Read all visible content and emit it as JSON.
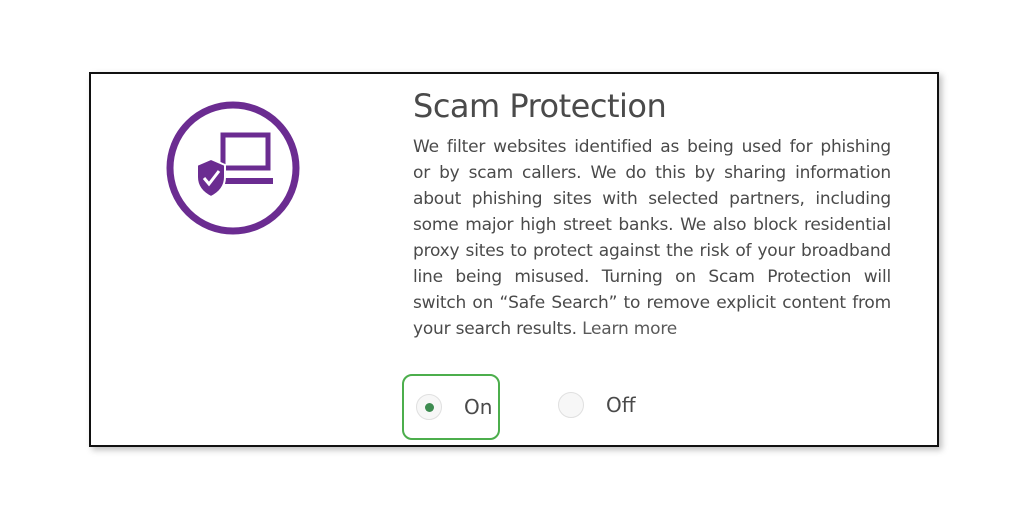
{
  "section": {
    "icon": "laptop-shield-check-icon",
    "title": "Scam Protection",
    "description": "We filter websites identified as being used for phishing or by scam callers. We do this by sharing information about phishing sites with selected partners, including some major high street banks. We also block residential proxy sites to protect against the risk of your broadband line being misused. Turning on Scam Protection will switch on “Safe Search” to remove explicit content from your search results.",
    "learn_more": "Learn more"
  },
  "toggle": {
    "options": [
      {
        "label": "On",
        "selected": true
      },
      {
        "label": "Off",
        "selected": false
      }
    ]
  },
  "colors": {
    "icon_purple": "#6b2c91",
    "selected_green": "#4cae4c",
    "radio_dot": "#3d8b50",
    "text": "#4a4a4a"
  }
}
